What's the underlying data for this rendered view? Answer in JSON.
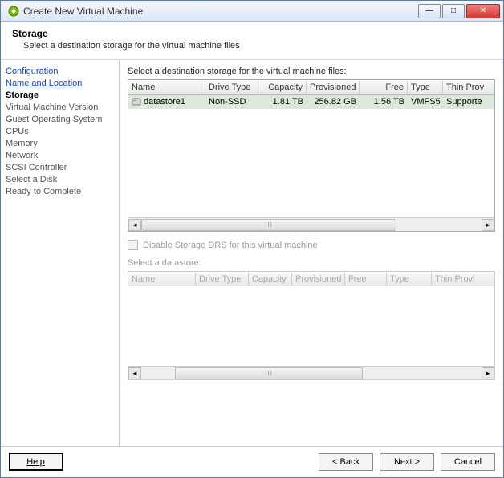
{
  "window": {
    "title": "Create New Virtual Machine"
  },
  "header": {
    "title": "Storage",
    "subtitle": "Select a destination storage for the virtual machine files"
  },
  "sidebar": {
    "items": [
      {
        "label": "Configuration",
        "kind": "link"
      },
      {
        "label": "Name and Location",
        "kind": "link"
      },
      {
        "label": "Storage",
        "kind": "current"
      },
      {
        "label": "Virtual Machine Version",
        "kind": "normal"
      },
      {
        "label": "Guest Operating System",
        "kind": "normal"
      },
      {
        "label": "CPUs",
        "kind": "normal"
      },
      {
        "label": "Memory",
        "kind": "normal"
      },
      {
        "label": "Network",
        "kind": "normal"
      },
      {
        "label": "SCSI Controller",
        "kind": "normal"
      },
      {
        "label": "Select a Disk",
        "kind": "normal"
      },
      {
        "label": "Ready to Complete",
        "kind": "normal"
      }
    ]
  },
  "main": {
    "instruction": "Select a destination storage for the virtual machine files:",
    "table1": {
      "headers": {
        "name": "Name",
        "drive_type": "Drive Type",
        "capacity": "Capacity",
        "provisioned": "Provisioned",
        "free": "Free",
        "type": "Type",
        "thin": "Thin Prov"
      },
      "rows": [
        {
          "name": "datastore1",
          "drive_type": "Non-SSD",
          "capacity": "1.81 TB",
          "provisioned": "256.82 GB",
          "free": "1.56 TB",
          "type": "VMFS5",
          "thin": "Supporte"
        }
      ]
    },
    "disable_drs_label": "Disable Storage DRS for this virtual machine",
    "select_datastore_label": "Select a datastore:",
    "table2": {
      "headers": {
        "name": "Name",
        "drive_type": "Drive Type",
        "capacity": "Capacity",
        "provisioned": "Provisioned",
        "free": "Free",
        "type": "Type",
        "thin": "Thin Provi"
      }
    }
  },
  "footer": {
    "help": "Help",
    "back": "< Back",
    "next": "Next >",
    "cancel": "Cancel"
  }
}
